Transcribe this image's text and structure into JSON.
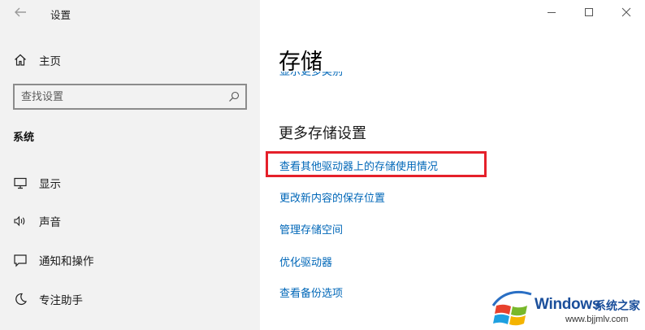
{
  "window": {
    "app_title": "设置",
    "controls": {
      "minimize": "minimize",
      "maximize": "maximize",
      "close": "close"
    }
  },
  "sidebar": {
    "home_label": "主页",
    "search_placeholder": "查找设置",
    "section_title": "系统",
    "items": [
      {
        "label": "显示",
        "icon": "monitor-icon"
      },
      {
        "label": "声音",
        "icon": "speaker-icon"
      },
      {
        "label": "通知和操作",
        "icon": "notification-icon"
      },
      {
        "label": "专注助手",
        "icon": "moon-icon"
      }
    ]
  },
  "main": {
    "page_title": "存储",
    "cut_link": "显示更多类别",
    "subheading": "更多存储设置",
    "links": [
      "查看其他驱动器上的存储使用情况",
      "更改新内容的保存位置",
      "管理存储空间",
      "优化驱动器",
      "查看备份选项"
    ],
    "highlight_color": "#e5202a",
    "link_color": "#0067b8"
  },
  "watermark": {
    "brand": "Windows",
    "site_cn": "系统之家",
    "url": "www.bjjmlv.com"
  }
}
